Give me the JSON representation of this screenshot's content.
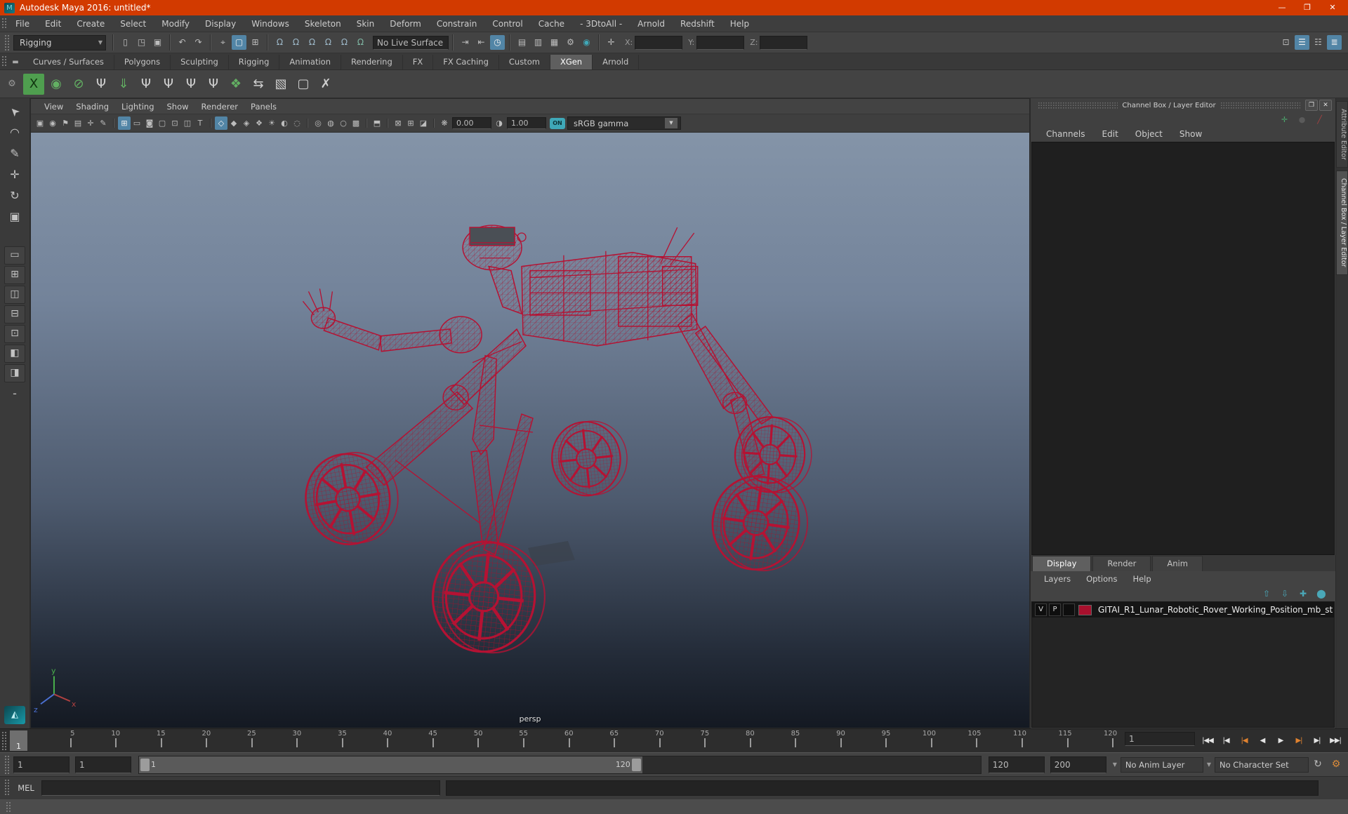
{
  "titlebar": {
    "title": "Autodesk Maya 2016: untitled*",
    "logo_glyph": "M",
    "window_buttons": [
      {
        "name": "minimize-button",
        "glyph": "—"
      },
      {
        "name": "restore-button",
        "glyph": "❐"
      },
      {
        "name": "close-button",
        "glyph": "✕"
      }
    ]
  },
  "menubar": {
    "items": [
      "File",
      "Edit",
      "Create",
      "Select",
      "Modify",
      "Display",
      "Windows",
      "Skeleton",
      "Skin",
      "Deform",
      "Constrain",
      "Control",
      "Cache",
      "- 3DtoAll -",
      "Arnold",
      "Redshift",
      "Help"
    ]
  },
  "toolbar": {
    "mode_selector": "Rigging",
    "file_icons": [
      {
        "name": "new-scene-icon",
        "glyph": "▯"
      },
      {
        "name": "open-scene-icon",
        "glyph": "◳"
      },
      {
        "name": "save-scene-icon",
        "glyph": "▣"
      }
    ],
    "undo_icons": [
      {
        "name": "undo-icon",
        "glyph": "↶"
      },
      {
        "name": "redo-icon",
        "glyph": "↷"
      }
    ],
    "select_icons": [
      {
        "name": "select-by-hierarchy-icon",
        "glyph": "⌖"
      },
      {
        "name": "select-by-object-icon",
        "glyph": "▢",
        "active": true
      },
      {
        "name": "select-by-component-icon",
        "glyph": "⊞"
      }
    ],
    "snap_icons": [
      {
        "name": "snap-to-grid-icon",
        "glyph": "Ω",
        "color": "#9db8c8"
      },
      {
        "name": "snap-to-curve-icon",
        "glyph": "Ω",
        "color": "#9db8c8"
      },
      {
        "name": "snap-to-point-icon",
        "glyph": "Ω",
        "color": "#9db8c8"
      },
      {
        "name": "snap-to-projected-center-icon",
        "glyph": "Ω",
        "color": "#9db8c8"
      },
      {
        "name": "snap-to-view-plane-icon",
        "glyph": "Ω",
        "color": "#9db8c8"
      },
      {
        "name": "make-live-icon",
        "glyph": "Ω",
        "color": "#7fb7a4"
      }
    ],
    "live_surface": "No Live Surface",
    "history_icons": [
      {
        "name": "input-connections-icon",
        "glyph": "⇥"
      },
      {
        "name": "output-connections-icon",
        "glyph": "⇤"
      },
      {
        "name": "construction-history-icon",
        "glyph": "◷",
        "active": true
      }
    ],
    "render_icons": [
      {
        "name": "open-render-view-icon",
        "glyph": "▤"
      },
      {
        "name": "render-current-frame-icon",
        "glyph": "▥"
      },
      {
        "name": "ipr-render-icon",
        "glyph": "▦"
      },
      {
        "name": "render-settings-icon",
        "glyph": "⚙"
      },
      {
        "name": "hypershade-icon",
        "glyph": "◉",
        "color": "#3fa8b8"
      }
    ],
    "transform_icon": {
      "name": "absolute-transform-icon",
      "glyph": "✛"
    },
    "x_label": "X:",
    "y_label": "Y:",
    "z_label": "Z:",
    "x_value": "",
    "y_value": "",
    "z_value": "",
    "panel_toggles": [
      {
        "name": "outliner-toggle-icon",
        "glyph": "⊡"
      },
      {
        "name": "tool-settings-toggle-icon",
        "glyph": "☰",
        "active": true
      },
      {
        "name": "attribute-editor-toggle-icon",
        "glyph": "☷"
      },
      {
        "name": "channel-box-toggle-icon",
        "glyph": "≣",
        "active": true
      }
    ]
  },
  "shelf": {
    "tabs": [
      "Curves / Surfaces",
      "Polygons",
      "Sculpting",
      "Rigging",
      "Animation",
      "Rendering",
      "FX",
      "FX Caching",
      "Custom",
      "XGen",
      "Arnold"
    ],
    "active_tab": "XGen",
    "menu_glyph": "▬",
    "gear_glyph": "⚙",
    "icons": [
      {
        "name": "xgen-editor-icon",
        "glyph": "X",
        "bg": "#4f9e4f",
        "color": "#10350f"
      },
      {
        "name": "xgen-update-preview-icon",
        "glyph": "◉",
        "color": "#63b063"
      },
      {
        "name": "xgen-disable-preview-icon",
        "glyph": "⊘",
        "color": "#63b063"
      },
      {
        "name": "xgen-create-description-icon",
        "glyph": "Ψ",
        "color": "#cfcfcf"
      },
      {
        "name": "xgen-export-selection-icon",
        "glyph": "⇓",
        "color": "#63b063"
      },
      {
        "name": "xgen-add-guide-icon",
        "glyph": "Ψ",
        "color": "#cfcfcf"
      },
      {
        "name": "xgen-guide-visibility-icon",
        "glyph": "Ψ",
        "color": "#cfcfcf"
      },
      {
        "name": "xgen-lock-guides-icon",
        "glyph": "Ψ",
        "color": "#cfcfcf"
      },
      {
        "name": "xgen-comb-part-icon",
        "glyph": "Ψ",
        "color": "#cfcfcf"
      },
      {
        "name": "xgen-update-layers-icon",
        "glyph": "❖",
        "color": "#63b063"
      },
      {
        "name": "xgen-width-tool-icon",
        "glyph": "⇆",
        "color": "#cfcfcf"
      },
      {
        "name": "xgen-select-brush-icon",
        "glyph": "▧",
        "color": "#cfcfcf"
      },
      {
        "name": "xgen-region-mask-icon",
        "glyph": "▢",
        "color": "#cfcfcf"
      },
      {
        "name": "xgen-clear-guides-icon",
        "glyph": "✗",
        "color": "#cfcfcf"
      }
    ]
  },
  "toolbox": {
    "tools": [
      {
        "name": "select-tool",
        "glyph": "➤",
        "cls": "sel"
      },
      {
        "name": "lasso-select-tool",
        "glyph": "◠"
      },
      {
        "name": "paint-select-tool",
        "glyph": "✎"
      },
      {
        "name": "move-tool",
        "glyph": "✛"
      },
      {
        "name": "rotate-tool",
        "glyph": "↻"
      },
      {
        "name": "scale-tool",
        "glyph": "▣"
      }
    ],
    "layouts": [
      {
        "name": "single-pane-layout-button",
        "glyph": "▭",
        "cls": "lay"
      },
      {
        "name": "four-pane-layout-button",
        "glyph": "⊞",
        "cls": "lay"
      },
      {
        "name": "persp-outliner-layout-button",
        "glyph": "◫",
        "cls": "lay"
      },
      {
        "name": "persp-graph-layout-button",
        "glyph": "⊟",
        "cls": "lay"
      },
      {
        "name": "hypershade-persp-layout-button",
        "glyph": "⊡",
        "cls": "lay"
      },
      {
        "name": "persp-uv-layout-button",
        "glyph": "◧",
        "cls": "lay"
      },
      {
        "name": "persp-multi-layout-button",
        "glyph": "◨",
        "cls": "lay"
      }
    ],
    "more_glyph": "-"
  },
  "viewport": {
    "menus": [
      "View",
      "Shading",
      "Lighting",
      "Show",
      "Renderer",
      "Panels"
    ],
    "icons": [
      {
        "name": "select-camera-icon",
        "glyph": "▣"
      },
      {
        "name": "lock-camera-icon",
        "glyph": "◉"
      },
      {
        "name": "camera-attributes-icon",
        "glyph": "⚑"
      },
      {
        "name": "bookmark-icon",
        "glyph": "▤"
      },
      {
        "name": "image-plane-icon",
        "glyph": "✛"
      },
      {
        "name": "grease-pencil-icon",
        "glyph": "✎"
      },
      {
        "sep": true
      },
      {
        "name": "grid-icon",
        "glyph": "⊞",
        "active": true
      },
      {
        "name": "film-gate-icon",
        "glyph": "▭"
      },
      {
        "name": "resolution-gate-icon",
        "glyph": "◙"
      },
      {
        "name": "gate-mask-icon",
        "glyph": "▢"
      },
      {
        "name": "field-chart-icon",
        "glyph": "⊡"
      },
      {
        "name": "safe-action-icon",
        "glyph": "◫"
      },
      {
        "name": "safe-title-icon",
        "glyph": "T"
      },
      {
        "sep": true
      },
      {
        "name": "wireframe-icon",
        "glyph": "◇",
        "active": true
      },
      {
        "name": "shaded-icon",
        "glyph": "◆"
      },
      {
        "name": "wireframe-on-shaded-icon",
        "glyph": "◈"
      },
      {
        "name": "textured-icon",
        "glyph": "❖"
      },
      {
        "name": "use-all-lights-icon",
        "glyph": "☀"
      },
      {
        "name": "shadows-icon",
        "glyph": "◐"
      },
      {
        "name": "screen-space-ao-icon",
        "glyph": "◌"
      },
      {
        "sep": true
      },
      {
        "name": "motion-blur-icon",
        "glyph": "◎"
      },
      {
        "name": "multisample-icon",
        "glyph": "◍"
      },
      {
        "name": "depth-of-field-icon",
        "glyph": "○"
      },
      {
        "name": "isolate-select-icon",
        "glyph": "▩"
      },
      {
        "sep": true
      },
      {
        "name": "xray-icon",
        "glyph": "⬒"
      },
      {
        "sep": true
      },
      {
        "name": "xray-joints-icon",
        "glyph": "⊠"
      },
      {
        "name": "xray-active-icon",
        "glyph": "⊞"
      },
      {
        "name": "plugin-shading-icon",
        "glyph": "◪"
      },
      {
        "sep": true
      },
      {
        "name": "exposure-icon",
        "glyph": "❋"
      }
    ],
    "exposure_value": "0.00",
    "contrast_icon": "◑",
    "gamma_value": "1.00",
    "on_toggle": "ON",
    "color_space": "sRGB gamma",
    "camera_label": "persp",
    "axis_labels": {
      "x": "x",
      "y": "y",
      "z": "z"
    }
  },
  "channel_box": {
    "title": "Channel Box / Layer Editor",
    "float_glyph": "❐",
    "close_glyph": "✕",
    "header_icons": [
      {
        "name": "manipulator-icon",
        "glyph": "✛",
        "color": "#4ca56c"
      },
      {
        "name": "speed-ball-icon",
        "glyph": "●",
        "color": "#5a5a5a"
      },
      {
        "name": "pencil-key-icon",
        "glyph": "╱",
        "color": "#a84040"
      }
    ],
    "menus": [
      "Channels",
      "Edit",
      "Object",
      "Show"
    ],
    "layer_tabs": [
      "Display",
      "Render",
      "Anim"
    ],
    "active_layer_tab": "Display",
    "layer_menus": [
      "Layers",
      "Options",
      "Help"
    ],
    "layer_icons": [
      {
        "name": "move-layer-up-icon",
        "glyph": "⇧"
      },
      {
        "name": "move-layer-down-icon",
        "glyph": "⇩"
      },
      {
        "name": "create-empty-layer-icon",
        "glyph": "✚"
      },
      {
        "name": "create-layer-from-selected-icon",
        "glyph": "⬤"
      }
    ],
    "layer": {
      "visibility": "V",
      "playback": "P",
      "color": "#a8102d",
      "name": "GITAI_R1_Lunar_Robotic_Rover_Working_Position_mb_st"
    },
    "side_tabs": [
      {
        "label": "Attribute Editor",
        "active": false
      },
      {
        "label": "Channel Box / Layer Editor",
        "active": true
      }
    ]
  },
  "timeline": {
    "current_frame": "1",
    "ticks": [
      5,
      10,
      15,
      20,
      25,
      30,
      35,
      40,
      45,
      50,
      55,
      60,
      65,
      70,
      75,
      80,
      85,
      90,
      95,
      100,
      105,
      110,
      115,
      120
    ],
    "frame_field": "1",
    "playback": [
      {
        "name": "go-to-start-button",
        "glyph": "|◀◀"
      },
      {
        "name": "step-back-frame-button",
        "glyph": "|◀"
      },
      {
        "name": "step-back-key-button",
        "glyph": "|◀",
        "key": true
      },
      {
        "name": "play-backwards-button",
        "glyph": "◀"
      },
      {
        "name": "play-forwards-button",
        "glyph": "▶"
      },
      {
        "name": "step-forward-key-button",
        "glyph": "▶|",
        "key": true
      },
      {
        "name": "step-forward-frame-button",
        "glyph": "▶|"
      },
      {
        "name": "go-to-end-button",
        "glyph": "▶▶|"
      }
    ]
  },
  "range_slider": {
    "anim_start": "1",
    "playback_start": "1",
    "range_start_label": "1",
    "range_end_label": "120",
    "playback_end": "120",
    "anim_end": "200",
    "anim_layer": "No Anim Layer",
    "character_set": "No Character Set",
    "auto_key_glyph": "↻",
    "prefs_glyph": "⚙"
  },
  "command_line": {
    "label": "MEL",
    "input_value": ""
  },
  "colors": {
    "titlebar_orange": "#d23a00",
    "active_blue": "#5285a6",
    "wireframe_red": "#b51233",
    "layer_swatch_red": "#a8102d",
    "teal_accent": "#3fa8b8"
  }
}
